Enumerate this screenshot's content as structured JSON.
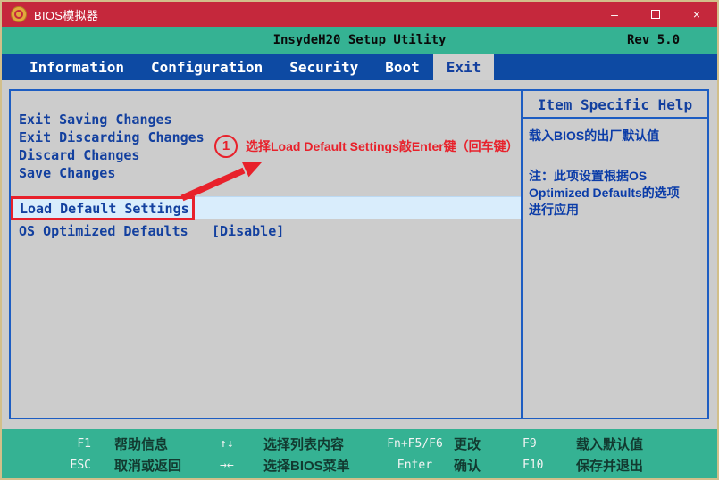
{
  "titlebar": {
    "title": "BIOS模拟器",
    "minimize_glyph": "–",
    "close_glyph": "×"
  },
  "header": {
    "title": "InsydeH20 Setup Utility",
    "revision": "Rev 5.0"
  },
  "tabs": [
    {
      "label": "Information",
      "active": false
    },
    {
      "label": "Configuration",
      "active": false
    },
    {
      "label": "Security",
      "active": false
    },
    {
      "label": "Boot",
      "active": false
    },
    {
      "label": "Exit",
      "active": true
    }
  ],
  "exit_menu": {
    "items": [
      "Exit Saving Changes",
      "Exit Discarding Changes",
      "Discard Changes",
      "Save Changes"
    ],
    "highlighted_item": "Load Default Settings",
    "os_row": {
      "label": "OS Optimized Defaults",
      "value": "[Disable]"
    }
  },
  "annotation": {
    "step": "1",
    "text": "选择Load Default Settings敲Enter键（回车键）"
  },
  "help": {
    "title": "Item Specific Help",
    "line1": "载入BIOS的出厂默认值",
    "note_lines": [
      "注：此项设置根据OS",
      "Optimized Defaults的选项",
      "进行应用"
    ]
  },
  "footer": {
    "rows": [
      [
        {
          "key": "F1",
          "label": "帮助信息"
        },
        {
          "key": "↑↓",
          "label": "选择列表内容"
        },
        {
          "key": "Fn+F5/F6",
          "label": "更改"
        },
        {
          "key": "F9",
          "label": "载入默认值"
        }
      ],
      [
        {
          "key": "ESC",
          "label": "取消或返回"
        },
        {
          "key": "→←",
          "label": "选择BIOS菜单"
        },
        {
          "key": "Enter",
          "label": "确认"
        },
        {
          "key": "F10",
          "label": "保存并退出"
        }
      ]
    ]
  },
  "colors": {
    "titlebar_red": "#c5283c",
    "bios_green": "#35b293",
    "menu_blue": "#0d4aa3",
    "panel_border_blue": "#1d5dc2",
    "item_text_blue": "#13409f",
    "help_text_blue": "#0b3ca8",
    "highlight_bg": "#d9edfc",
    "annotation_red": "#e8212b",
    "window_border_tan": "#d2bf8a",
    "content_gray": "#cccccc"
  }
}
